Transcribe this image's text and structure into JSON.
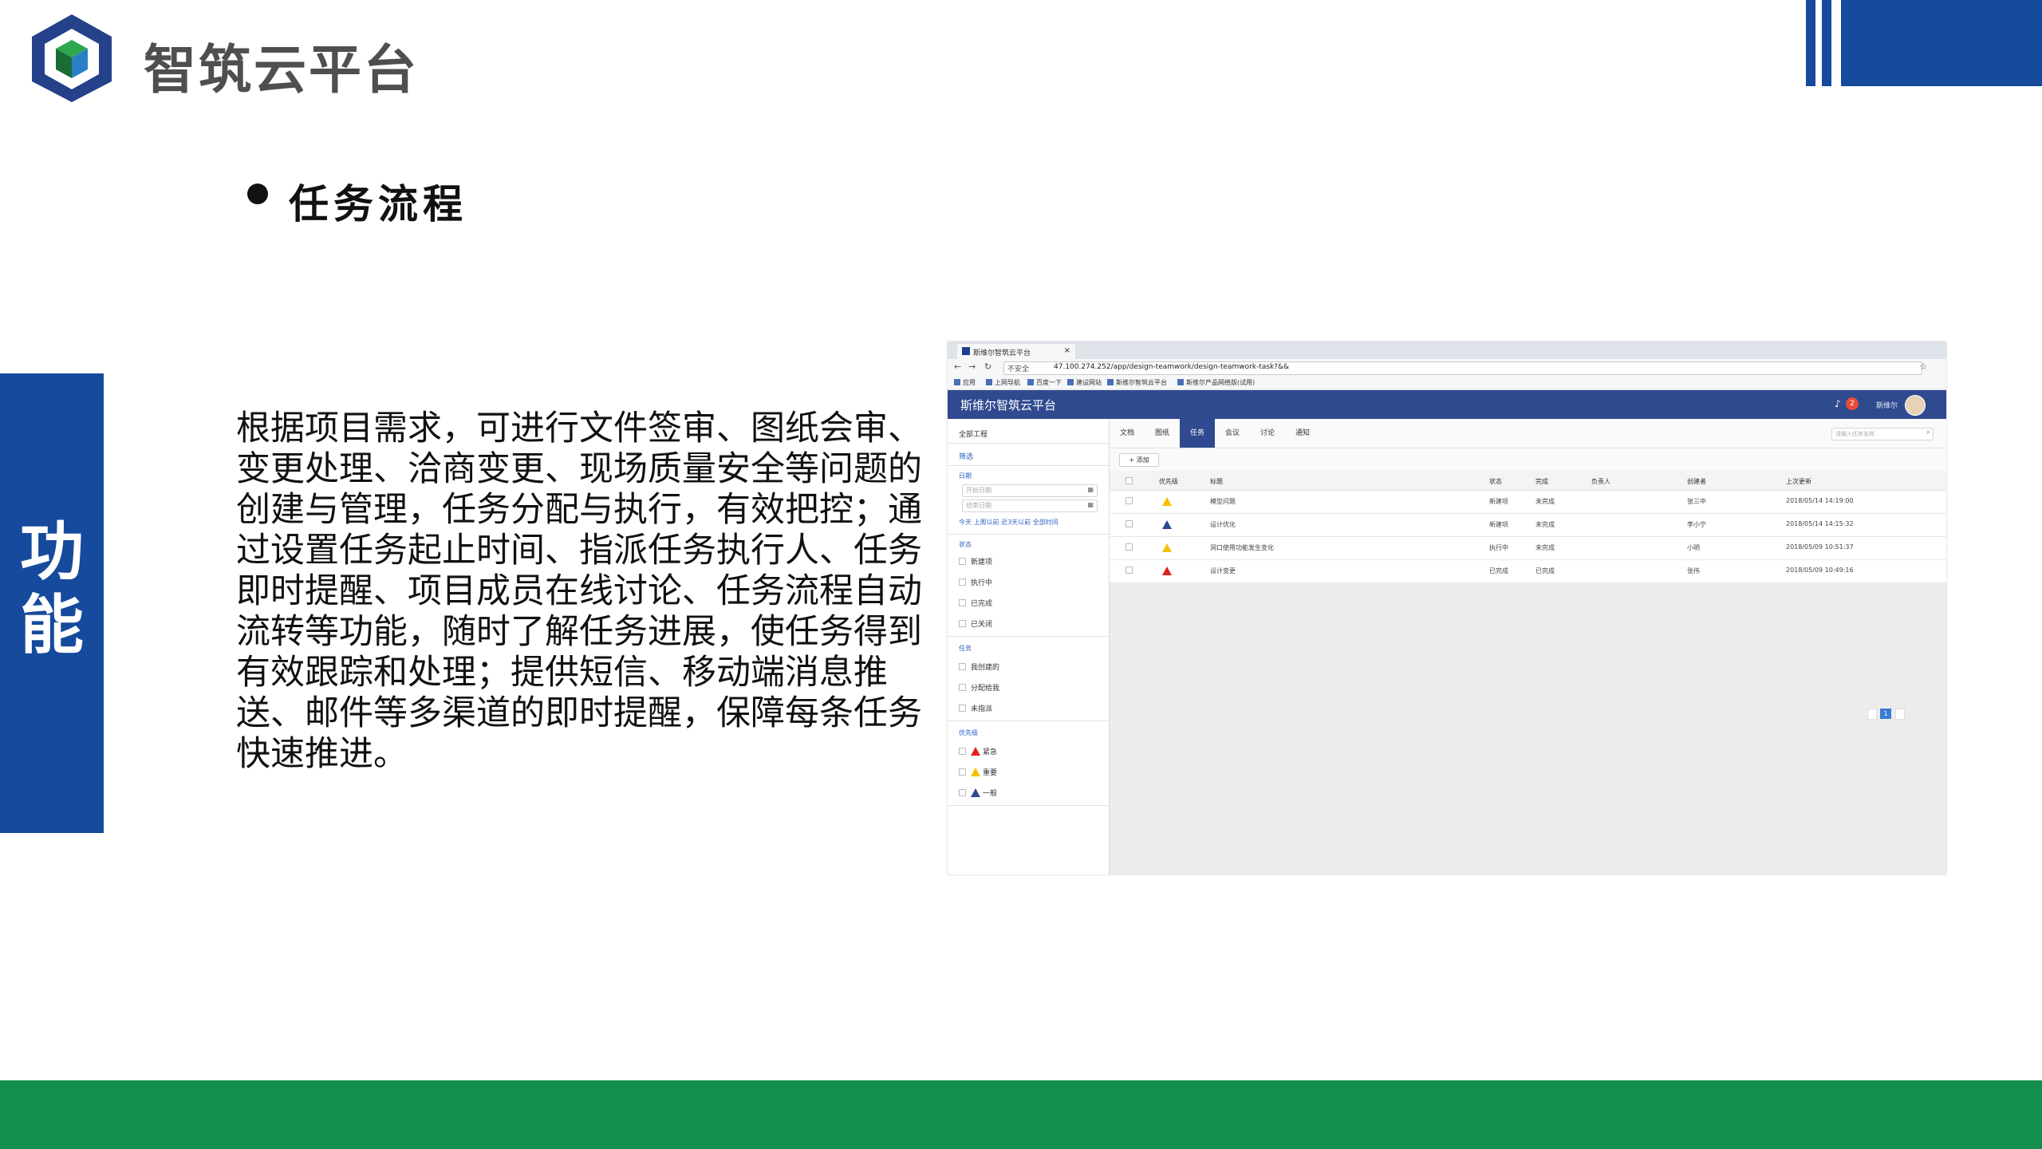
{
  "brand": {
    "name": "智筑云平台"
  },
  "section": {
    "title": "任务流程"
  },
  "side_tab": {
    "label": "功能"
  },
  "description": "根据项目需求，可进行文件签审、图纸会审、变更处理、洽商变更、现场质量安全等问题的创建与管理，任务分配与执行，有效把控；通过设置任务起止时间、指派任务执行人、任务即时提醒、项目成员在线讨论、任务流程自动流转等功能，随时了解任务进展，使任务得到有效跟踪和处理；提供短信、移动端消息推送、邮件等多渠道的即时提醒，保障每条任务快速推进。",
  "colors": {
    "brand_blue": "#164a9c",
    "bottom_green": "#148e4c",
    "app_header": "#2f4a8f"
  },
  "browser": {
    "tab_title": "斯维尔智筑云平台",
    "url_prefix": "不安全",
    "url": "47.100.274.252/app/design-teamwork/design-teamwork-task?&&",
    "bookmarks": [
      "应用",
      "上网导航",
      "百度一下",
      "建设网站",
      "斯维尔智筑云平台",
      "斯维尔产品网络版(试用)"
    ]
  },
  "app": {
    "title": "斯维尔智筑云平台",
    "notification_count": "2",
    "user_name": "斯维尔",
    "sidebar": {
      "project": "全部工程",
      "filter_link": "筛选",
      "date_heading": "日期",
      "start_placeholder": "开始日期",
      "end_placeholder": "结束日期",
      "quick_dates": "今天 上周以前 近3天以前 全部时间",
      "status_heading": "状态",
      "status_items": [
        "新建项",
        "执行中",
        "已完成",
        "已关闭"
      ],
      "assign_heading": "任务",
      "assign_items": [
        "我创建的",
        "分配给我",
        "未指派"
      ],
      "priority_heading": "优先级",
      "priority_items": [
        "紧急",
        "重要",
        "一般"
      ]
    },
    "tabs": [
      "文档",
      "图纸",
      "任务",
      "会议",
      "讨论",
      "通知"
    ],
    "active_tab": "任务",
    "search_placeholder": "请输入任务名称",
    "add_button": "+ 添加",
    "table": {
      "headers": [
        "优先级",
        "标题",
        "状态",
        "完成",
        "负责人",
        "创建者",
        "上次更新"
      ],
      "rows": [
        {
          "priority": "重要",
          "priority_color": "#f2c200",
          "title": "模型问题",
          "status": "新建项",
          "completion": "未完成",
          "owner": "",
          "creator": "张三中",
          "updated": "2018/05/14 14:19:00"
        },
        {
          "priority": "一般",
          "priority_color": "#2f4a8f",
          "title": "设计优化",
          "status": "新建项",
          "completion": "未完成",
          "owner": "",
          "creator": "李小宁",
          "updated": "2018/05/14 14:15:32"
        },
        {
          "priority": "重要",
          "priority_color": "#f2c200",
          "title": "洞口使用功能发生变化",
          "status": "执行中",
          "completion": "未完成",
          "owner": "",
          "creator": "小明",
          "updated": "2018/05/09 10:51:37"
        },
        {
          "priority": "紧急",
          "priority_color": "#e02020",
          "title": "设计变更",
          "status": "已完成",
          "completion": "已完成",
          "owner": "",
          "creator": "张伟",
          "updated": "2018/05/09 10:49:16"
        }
      ]
    },
    "pager": {
      "page": "1"
    }
  }
}
